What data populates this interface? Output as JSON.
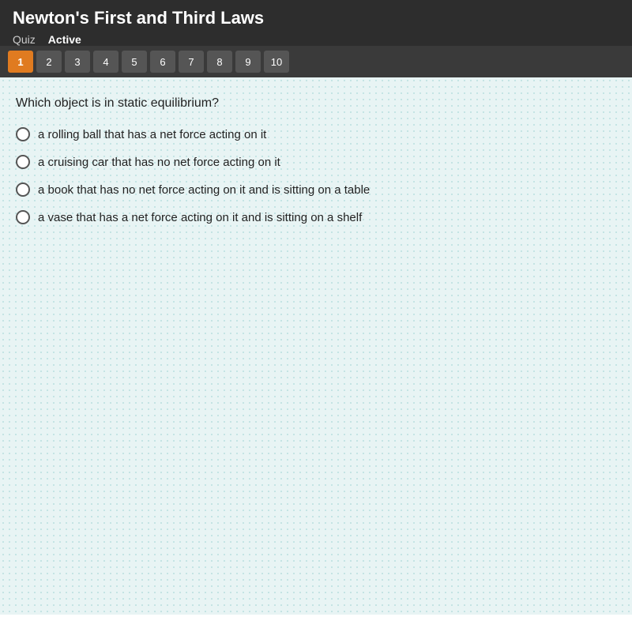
{
  "header": {
    "title": "Newton's First and Third Laws",
    "quiz_label": "Quiz",
    "status": "Active"
  },
  "navigation": {
    "buttons": [
      {
        "number": 1,
        "active": true
      },
      {
        "number": 2,
        "active": false
      },
      {
        "number": 3,
        "active": false
      },
      {
        "number": 4,
        "active": false
      },
      {
        "number": 5,
        "active": false
      },
      {
        "number": 6,
        "active": false
      },
      {
        "number": 7,
        "active": false
      },
      {
        "number": 8,
        "active": false
      },
      {
        "number": 9,
        "active": false
      },
      {
        "number": 10,
        "active": false
      }
    ]
  },
  "question": {
    "text": "Which object is in static equilibrium?",
    "options": [
      {
        "id": "a",
        "text": "a rolling ball that has a net force acting on it"
      },
      {
        "id": "b",
        "text": "a cruising car that has no net force acting on it"
      },
      {
        "id": "c",
        "text": "a book that has no net force acting on it and is sitting on a table"
      },
      {
        "id": "d",
        "text": "a vase that has a net force acting on it and is sitting on a shelf"
      }
    ]
  }
}
